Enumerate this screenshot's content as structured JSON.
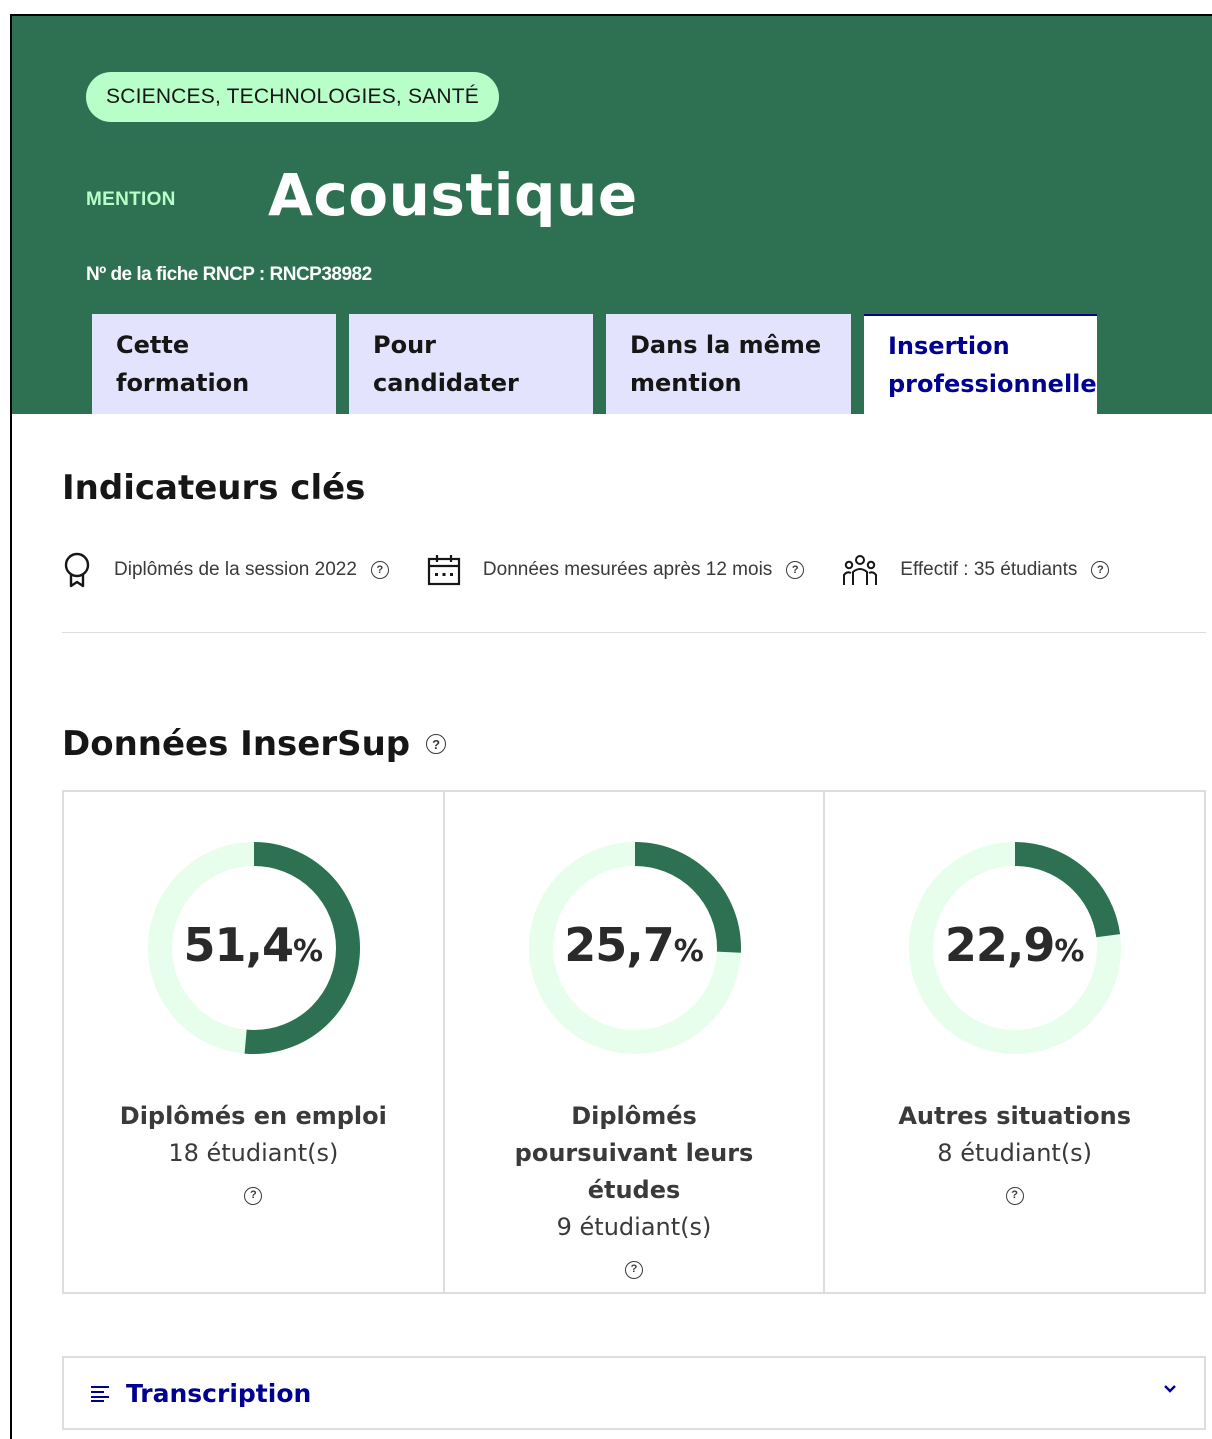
{
  "header": {
    "tag": "SCIENCES, TECHNOLOGIES, SANTÉ",
    "mention_label": "MENTION",
    "title": "Acoustique",
    "rncp": "Nº de la fiche RNCP : RNCP38982",
    "background_color": "#2d7152",
    "tag_color": "#b8fec9"
  },
  "tabs": [
    {
      "label": "Cette formation",
      "active": false
    },
    {
      "label": "Pour candidater",
      "active": false
    },
    {
      "label": "Dans la même mention",
      "active": false
    },
    {
      "label": "Insertion professionnelle",
      "active": true
    }
  ],
  "indicators": {
    "title": "Indicateurs clés",
    "items": [
      {
        "icon": "award-icon",
        "text": "Diplômés de la session 2022"
      },
      {
        "icon": "calendar-icon",
        "text": "Données mesurées après 12 mois"
      },
      {
        "icon": "group-icon",
        "text": "Effectif : 35 étudiants"
      }
    ]
  },
  "insersup": {
    "title": "Données InserSup",
    "cards": [
      {
        "value": 51.4,
        "value_text": "51,4",
        "unit": "%",
        "label": "Diplômés en emploi",
        "count": "18 étudiant(s)"
      },
      {
        "value": 25.7,
        "value_text": "25,7",
        "unit": "%",
        "label": "Diplômés poursuivant leurs études",
        "count": "9 étudiant(s)"
      },
      {
        "value": 22.9,
        "value_text": "22,9",
        "unit": "%",
        "label": "Autres situations",
        "count": "8 étudiant(s)"
      }
    ],
    "ring_color": "#2d7152",
    "track_color": "#e6feeb"
  },
  "accordion": {
    "label": "Transcription",
    "icon": "list-icon",
    "chevron": "chevron-down-icon"
  }
}
